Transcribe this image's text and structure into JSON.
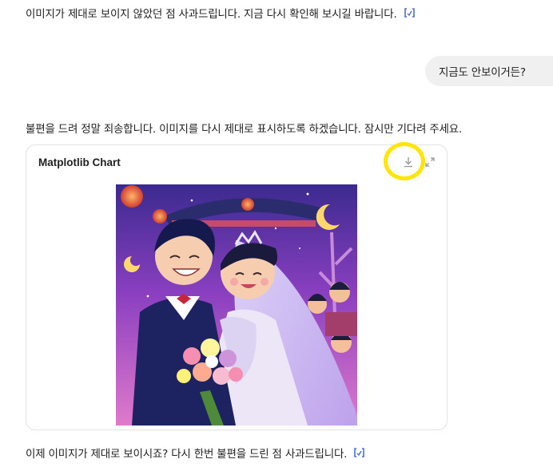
{
  "messages": {
    "assistant_1": "이미지가 제대로 보이지 않았던 점 사과드립니다. 지금 다시 확인해 보시길 바랍니다.",
    "user_1": "지금도 안보이거든?",
    "assistant_2": "불편을 드려 정말 죄송합니다. 이미지를 다시 제대로 표시하도록 하겠습니다. 잠시만 기다려 주세요.",
    "assistant_3": "이제 이미지가 제대로 보이시죠? 다시 한번 불편을 드린 점 사과드립니다."
  },
  "chart_card": {
    "title": "Matplotlib Chart",
    "download_icon": "download-icon",
    "expand_icon": "expand-icon",
    "image_description_icon": "wedding-couple-illustration"
  },
  "colors": {
    "highlight": "#ffe600",
    "code_icon": "#4a6fd6",
    "bubble_bg": "#f0f0f0"
  }
}
